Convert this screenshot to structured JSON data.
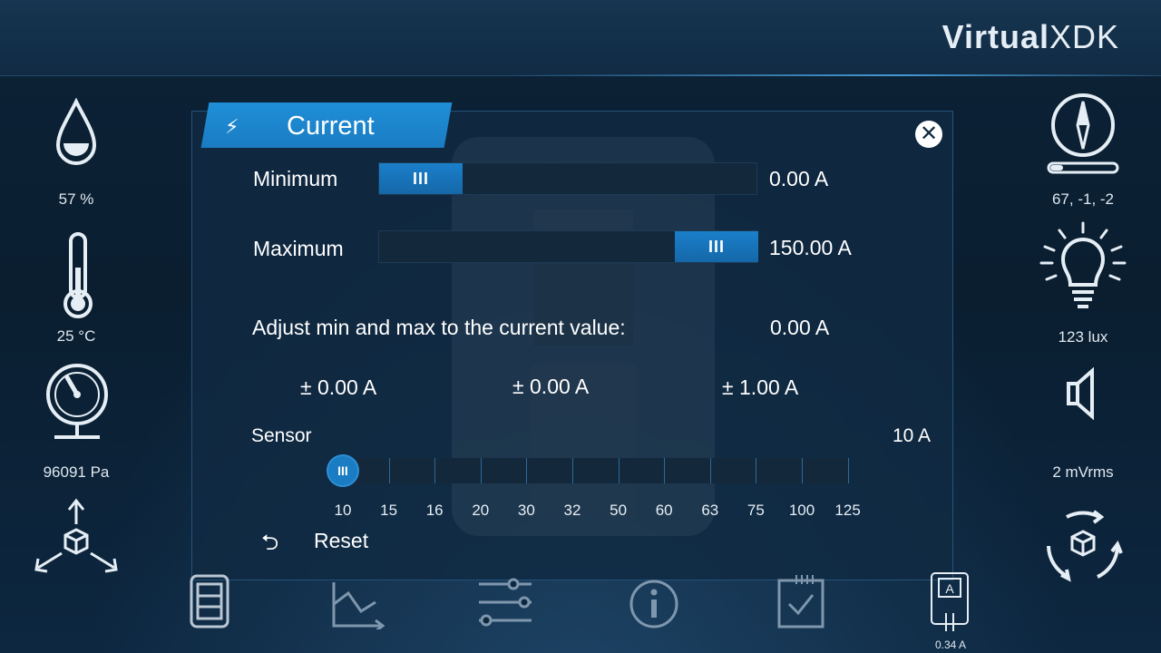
{
  "app": {
    "logo_bold": "Virtual",
    "logo_light": "XDK"
  },
  "left_sensors": [
    {
      "icon": "humidity-drop-icon",
      "value": "57 %"
    },
    {
      "icon": "thermometer-icon",
      "value": "25 °C"
    },
    {
      "icon": "pressure-gauge-icon",
      "value": "96091 Pa"
    },
    {
      "icon": "accelerometer-axes-icon"
    }
  ],
  "right_sensors": [
    {
      "icon": "compass-icon",
      "value": "67, -1, -2"
    },
    {
      "icon": "light-bulb-icon",
      "value": "123 lux"
    },
    {
      "icon": "speaker-icon",
      "value": "2 mVrms"
    },
    {
      "icon": "gyroscope-rotation-icon"
    }
  ],
  "modal": {
    "title": "Current",
    "minimum": {
      "label": "Minimum",
      "value": "0.00 A",
      "level": 0.0
    },
    "maximum": {
      "label": "Maximum",
      "value": "150.00 A",
      "level": 1.0
    },
    "adjust": {
      "label": "Adjust min and max to the current value:",
      "value": "0.00 A"
    },
    "offsets": [
      "± 0.00 A",
      "± 0.00 A",
      "± 1.00 A"
    ],
    "sensor": {
      "label": "Sensor",
      "value": "10 A",
      "ticks": [
        "10",
        "15",
        "16",
        "20",
        "30",
        "32",
        "50",
        "60",
        "63",
        "75",
        "100",
        "125"
      ],
      "selected_index": 0
    },
    "reset_label": "Reset",
    "handle_glyph": "III"
  },
  "bottom_nav": [
    {
      "icon": "device-icon"
    },
    {
      "icon": "chart-axes-icon"
    },
    {
      "icon": "sliders-icon"
    },
    {
      "icon": "info-icon"
    },
    {
      "icon": "checklist-icon"
    },
    {
      "icon": "ammeter-icon",
      "label": "0.34 A"
    }
  ]
}
